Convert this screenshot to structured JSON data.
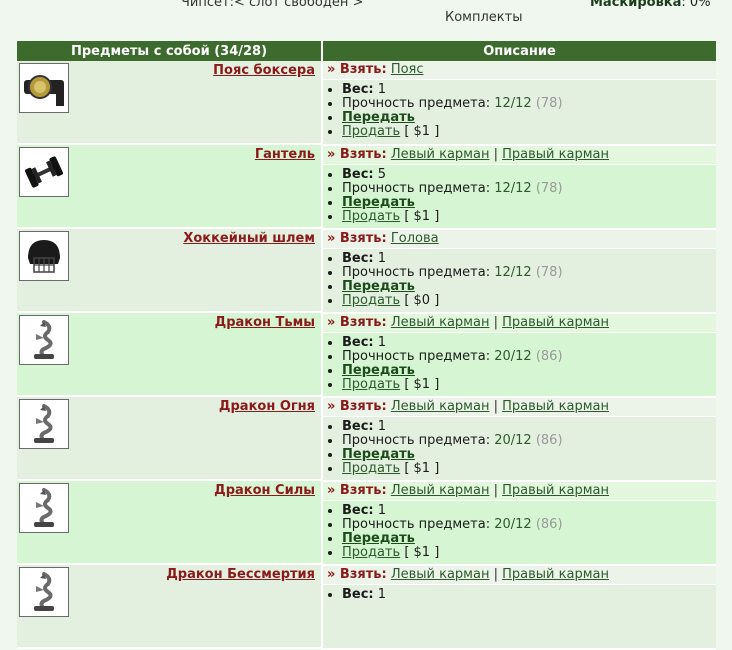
{
  "header": {
    "chipset_label": "Чипсет:",
    "chipset_value": "< слот свободен >",
    "kits_link": "Комплекты",
    "mask_label": "Маскировка",
    "mask_value": ": 0%"
  },
  "table": {
    "col_items": "Предметы с собой (34/28)",
    "col_desc": "Описание"
  },
  "labels": {
    "take": "» Взять:",
    "weight": "Вес:",
    "durability": "Прочность предмета:",
    "give": "Передать",
    "sell": "Продать",
    "separator": "|"
  },
  "items": [
    {
      "name": "Пояс боксера",
      "icon": "boxer-belt-icon",
      "slots": [
        "Пояс"
      ],
      "weight": "1",
      "durability": "12/12",
      "durability_max": "(78)",
      "price": "[ $1 ]"
    },
    {
      "name": "Гантель",
      "icon": "dumbbell-icon",
      "slots": [
        "Левый карман",
        "Правый карман"
      ],
      "weight": "5",
      "durability": "12/12",
      "durability_max": "(78)",
      "price": "[ $1 ]"
    },
    {
      "name": "Хоккейный шлем",
      "icon": "hockey-helmet-icon",
      "slots": [
        "Голова"
      ],
      "weight": "1",
      "durability": "12/12",
      "durability_max": "(78)",
      "price": "[ $0 ]"
    },
    {
      "name": "Дракон Тьмы",
      "icon": "dragon-statue-icon",
      "slots": [
        "Левый карман",
        "Правый карман"
      ],
      "weight": "1",
      "durability": "20/12",
      "durability_max": "(86)",
      "price": "[ $1 ]"
    },
    {
      "name": "Дракон Огня",
      "icon": "dragon-statue-icon",
      "slots": [
        "Левый карман",
        "Правый карман"
      ],
      "weight": "1",
      "durability": "20/12",
      "durability_max": "(86)",
      "price": "[ $1 ]"
    },
    {
      "name": "Дракон Силы",
      "icon": "dragon-statue-icon",
      "slots": [
        "Левый карман",
        "Правый карман"
      ],
      "weight": "1",
      "durability": "20/12",
      "durability_max": "(86)",
      "price": "[ $1 ]"
    },
    {
      "name": "Дракон Бессмертия",
      "icon": "dragon-statue-icon",
      "slots": [
        "Левый карман",
        "Правый карман"
      ],
      "weight": "1",
      "durability": "",
      "durability_max": "",
      "price": ""
    }
  ],
  "colors": {
    "header_bg": "#3d6b2e",
    "item_name": "#8b1a1a",
    "link": "#2c5a2c"
  }
}
